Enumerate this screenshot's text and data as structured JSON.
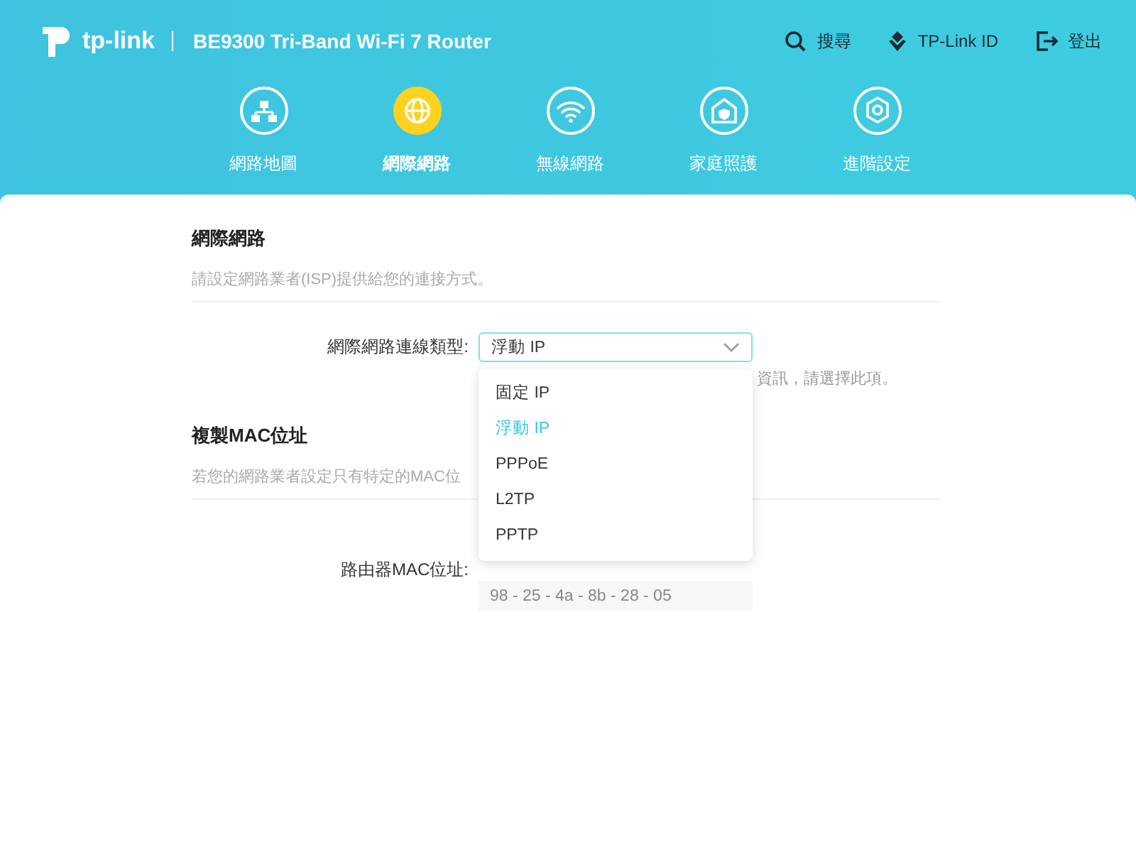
{
  "header": {
    "brand": "tp-link",
    "model": "BE9300 Tri-Band Wi-Fi 7 Router",
    "actions": [
      {
        "kind": "search",
        "label": "搜尋"
      },
      {
        "kind": "id",
        "label": "TP-Link ID"
      },
      {
        "kind": "logout",
        "label": "登出"
      }
    ]
  },
  "nav": [
    {
      "kind": "map",
      "label": "網路地圖",
      "selected": false
    },
    {
      "kind": "globe",
      "label": "網際網路",
      "selected": true
    },
    {
      "kind": "wifi",
      "label": "無線網路",
      "selected": false
    },
    {
      "kind": "home",
      "label": "家庭照護",
      "selected": false
    },
    {
      "kind": "gear",
      "label": "進階設定",
      "selected": false
    }
  ],
  "sections": [
    {
      "title": "網際網路",
      "description": "請設定網路業者(ISP)提供給您的連接方式。",
      "field": {
        "label": "網際網路連線類型:",
        "kind": "select",
        "value": "浮動 IP",
        "hint": "資訊，請選擇此項。",
        "options": [
          {
            "label": "固定 IP",
            "selected": false
          },
          {
            "label": "浮動 IP",
            "selected": true
          },
          {
            "label": "PPPoE",
            "selected": false
          },
          {
            "label": "L2TP",
            "selected": false
          },
          {
            "label": "PPTP",
            "selected": false
          }
        ]
      }
    },
    {
      "title": "複製MAC位址",
      "description": "若您的網路業者設定只有特定的MAC位",
      "field": {
        "label": "路由器MAC位址:",
        "kind": "text",
        "value": "98 - 25 - 4a - 8b - 28 - 05"
      }
    }
  ]
}
